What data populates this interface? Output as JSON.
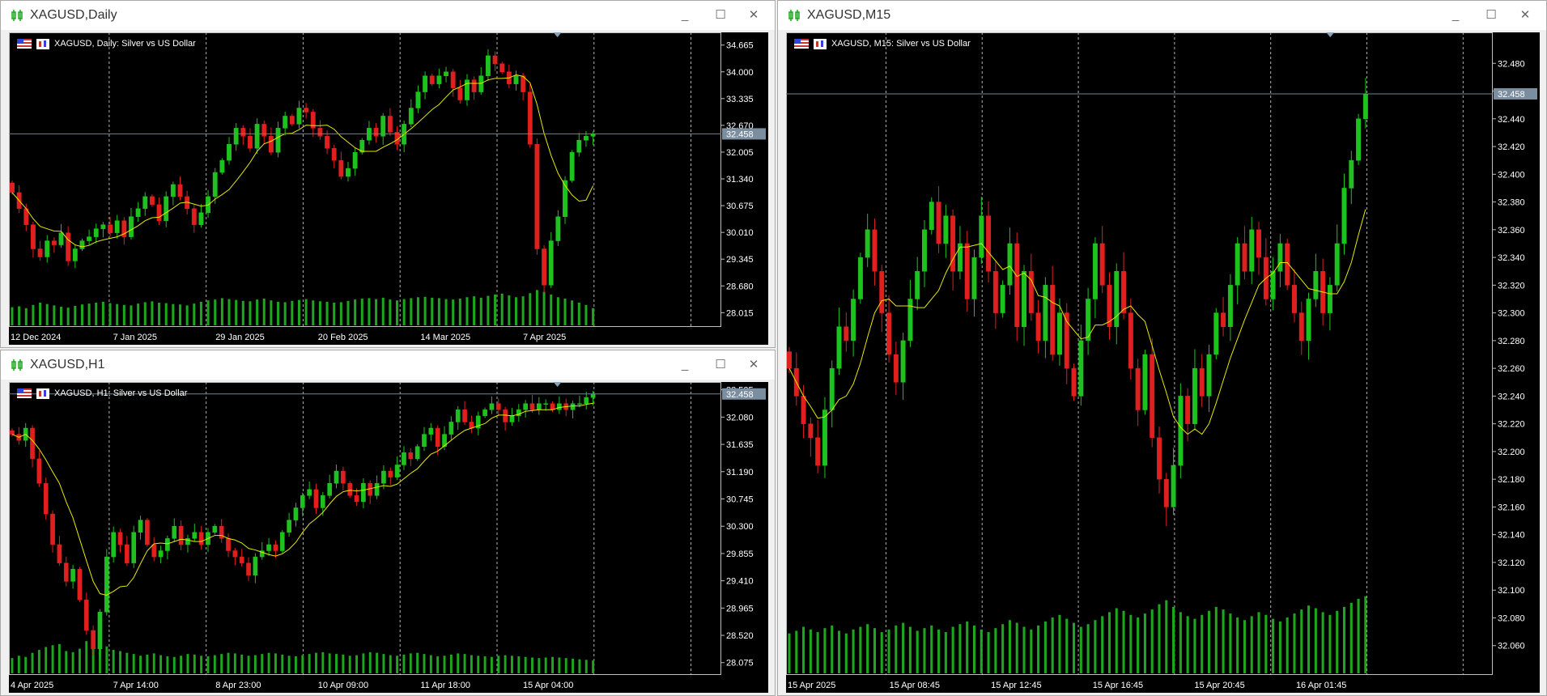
{
  "colors": {
    "bull": "#1ec21e",
    "bear": "#e01f1f",
    "ma": "#e8e800",
    "grid": "#d0d0d0",
    "price_line": "#6f8595",
    "price_badge_bg": "#7a8ea0",
    "chart_bg": "#000000",
    "volume": "#1ea61e"
  },
  "window_controls": {
    "minimize": "_",
    "maximize": "☐",
    "close": "✕"
  },
  "windows": [
    {
      "id": "daily",
      "title": "XAGUSD,Daily",
      "chart_label": "XAGUSD, Daily:  Silver vs US Dollar",
      "price_badge": "32.458",
      "y_ticks": [
        "34.665",
        "34.000",
        "33.335",
        "32.670",
        "32.005",
        "31.340",
        "30.675",
        "30.010",
        "29.345",
        "28.680",
        "28.015"
      ],
      "x_ticks": [
        "12 Dec 2024",
        "7 Jan 2025",
        "29 Jan 2025",
        "20 Feb 2025",
        "14 Mar 2025",
        "7 Apr 2025"
      ]
    },
    {
      "id": "h1",
      "title": "XAGUSD,H1",
      "chart_label": "XAGUSD, H1:  Silver vs US Dollar",
      "price_badge": "32.458",
      "y_ticks": [
        "32.525",
        "32.080",
        "31.635",
        "31.190",
        "30.745",
        "30.300",
        "29.855",
        "29.410",
        "28.965",
        "28.520",
        "28.075"
      ],
      "x_ticks": [
        "4 Apr 2025",
        "7 Apr 14:00",
        "8 Apr 23:00",
        "10 Apr 09:00",
        "11 Apr 18:00",
        "15 Apr 04:00"
      ]
    },
    {
      "id": "m15",
      "title": "XAGUSD,M15",
      "chart_label": "XAGUSD, M15:  Silver vs US Dollar",
      "price_badge": "32.458",
      "y_ticks": [
        "32.480",
        "32.460",
        "32.440",
        "32.420",
        "32.400",
        "32.380",
        "32.360",
        "32.340",
        "32.320",
        "32.300",
        "32.280",
        "32.260",
        "32.240",
        "32.220",
        "32.200",
        "32.180",
        "32.160",
        "32.140",
        "32.120",
        "32.100",
        "32.080",
        "32.060"
      ],
      "x_ticks": [
        "15 Apr 2025",
        "15 Apr 08:45",
        "15 Apr 12:45",
        "15 Apr 16:45",
        "15 Apr 20:45",
        "16 Apr 01:45"
      ]
    }
  ],
  "chart_data": [
    {
      "type": "candlestick",
      "title": "XAGUSD, Daily:  Silver vs US Dollar",
      "ylim": [
        27.7,
        34.9
      ],
      "current_price": 32.458,
      "moving_average": true,
      "grid": true,
      "close": [
        31.0,
        30.6,
        30.2,
        29.6,
        29.4,
        29.8,
        29.7,
        30.0,
        29.3,
        29.6,
        29.8,
        29.9,
        30.1,
        30.2,
        30.0,
        30.3,
        29.9,
        30.4,
        30.6,
        30.9,
        30.7,
        30.3,
        30.9,
        31.2,
        30.9,
        30.6,
        30.2,
        30.5,
        30.9,
        31.5,
        31.8,
        32.2,
        32.6,
        32.4,
        32.1,
        32.7,
        32.4,
        32.0,
        32.6,
        32.9,
        32.7,
        33.1,
        33.0,
        32.6,
        32.4,
        32.1,
        31.8,
        31.4,
        31.6,
        32.0,
        32.3,
        32.6,
        32.4,
        32.9,
        32.5,
        32.2,
        32.7,
        33.1,
        33.5,
        33.9,
        33.7,
        33.9,
        34.0,
        33.6,
        33.3,
        33.8,
        33.5,
        33.9,
        34.4,
        34.2,
        34.0,
        33.7,
        33.9,
        33.5,
        32.2,
        29.6,
        28.7,
        29.8,
        30.4,
        31.3,
        32.0,
        32.3,
        32.4,
        32.45
      ],
      "volume": [
        40,
        42,
        38,
        45,
        50,
        47,
        44,
        41,
        39,
        43,
        46,
        48,
        50,
        52,
        49,
        47,
        45,
        44,
        48,
        51,
        53,
        50,
        49,
        47,
        46,
        44,
        48,
        52,
        55,
        57,
        60,
        58,
        56,
        54,
        53,
        57,
        59,
        55,
        52,
        51,
        54,
        56,
        58,
        55,
        53,
        52,
        50,
        51,
        54,
        57,
        59,
        60,
        58,
        61,
        57,
        55,
        58,
        60,
        62,
        63,
        61,
        60,
        58,
        57,
        59,
        62,
        64,
        61,
        65,
        68,
        70,
        66,
        62,
        64,
        71,
        78,
        74,
        68,
        62,
        59,
        55,
        50,
        45,
        38
      ]
    },
    {
      "type": "candlestick",
      "title": "XAGUSD, H1:  Silver vs US Dollar",
      "ylim": [
        27.9,
        32.6
      ],
      "current_price": 32.458,
      "moving_average": true,
      "grid": true,
      "close": [
        31.8,
        31.7,
        31.9,
        31.4,
        31.0,
        30.5,
        30.0,
        29.7,
        29.4,
        29.6,
        29.1,
        28.6,
        28.3,
        28.9,
        29.8,
        30.2,
        30.0,
        29.7,
        30.2,
        30.4,
        30.0,
        29.8,
        29.9,
        30.1,
        30.3,
        30.0,
        30.1,
        30.2,
        30.0,
        30.2,
        30.3,
        30.1,
        29.9,
        29.8,
        29.7,
        29.5,
        29.8,
        29.9,
        30.0,
        29.9,
        30.2,
        30.4,
        30.6,
        30.8,
        30.9,
        30.6,
        30.8,
        31.0,
        31.2,
        31.0,
        30.8,
        30.7,
        31.0,
        30.8,
        31.0,
        31.2,
        31.1,
        31.3,
        31.5,
        31.4,
        31.6,
        31.8,
        31.9,
        31.6,
        31.8,
        32.0,
        32.2,
        32.0,
        31.9,
        32.1,
        32.2,
        32.3,
        32.2,
        32.0,
        32.1,
        32.2,
        32.3,
        32.2,
        32.3,
        32.3,
        32.2,
        32.3,
        32.2,
        32.3,
        32.3,
        32.4,
        32.45
      ],
      "volume": [
        26,
        30,
        28,
        35,
        40,
        45,
        48,
        50,
        38,
        36,
        42,
        55,
        60,
        50,
        46,
        40,
        38,
        35,
        33,
        30,
        32,
        34,
        31,
        29,
        28,
        30,
        33,
        32,
        30,
        29,
        31,
        33,
        35,
        34,
        32,
        30,
        31,
        33,
        35,
        34,
        32,
        30,
        29,
        31,
        33,
        35,
        36,
        34,
        33,
        32,
        30,
        31,
        34,
        36,
        35,
        33,
        31,
        30,
        32,
        34,
        35,
        33,
        31,
        29,
        30,
        32,
        34,
        33,
        31,
        30,
        29,
        28,
        30,
        31,
        30,
        29,
        28,
        27,
        26,
        27,
        28,
        27,
        26,
        25,
        24,
        23,
        22
      ]
    },
    {
      "type": "candlestick",
      "title": "XAGUSD, M15:  Silver vs US Dollar",
      "ylim": [
        32.04,
        32.5
      ],
      "current_price": 32.458,
      "moving_average": true,
      "grid": true,
      "close": [
        32.26,
        32.24,
        32.22,
        32.21,
        32.19,
        32.23,
        32.26,
        32.29,
        32.28,
        32.31,
        32.34,
        32.36,
        32.33,
        32.3,
        32.27,
        32.25,
        32.28,
        32.31,
        32.33,
        32.36,
        32.38,
        32.35,
        32.37,
        32.33,
        32.35,
        32.31,
        32.34,
        32.37,
        32.33,
        32.3,
        32.32,
        32.35,
        32.29,
        32.33,
        32.3,
        32.28,
        32.32,
        32.27,
        32.3,
        32.26,
        32.24,
        32.28,
        32.31,
        32.35,
        32.32,
        32.29,
        32.33,
        32.3,
        32.26,
        32.23,
        32.27,
        32.21,
        32.18,
        32.16,
        32.19,
        32.24,
        32.22,
        32.26,
        32.24,
        32.27,
        32.3,
        32.29,
        32.32,
        32.35,
        32.33,
        32.36,
        32.34,
        32.31,
        32.33,
        32.35,
        32.32,
        32.3,
        32.28,
        32.31,
        32.33,
        32.3,
        32.32,
        32.35,
        32.39,
        32.41,
        32.44,
        32.458
      ],
      "volume": [
        30,
        32,
        35,
        33,
        31,
        34,
        36,
        32,
        30,
        33,
        35,
        37,
        34,
        31,
        33,
        36,
        38,
        35,
        32,
        34,
        36,
        33,
        31,
        35,
        37,
        39,
        36,
        33,
        31,
        34,
        37,
        40,
        38,
        35,
        33,
        36,
        39,
        42,
        44,
        41,
        38,
        35,
        37,
        40,
        43,
        46,
        49,
        47,
        44,
        42,
        45,
        48,
        52,
        55,
        50,
        46,
        43,
        41,
        44,
        47,
        50,
        48,
        45,
        42,
        40,
        43,
        46,
        44,
        41,
        39,
        42,
        45,
        48,
        51,
        49,
        46,
        44,
        47,
        50,
        53,
        56,
        58
      ]
    }
  ]
}
